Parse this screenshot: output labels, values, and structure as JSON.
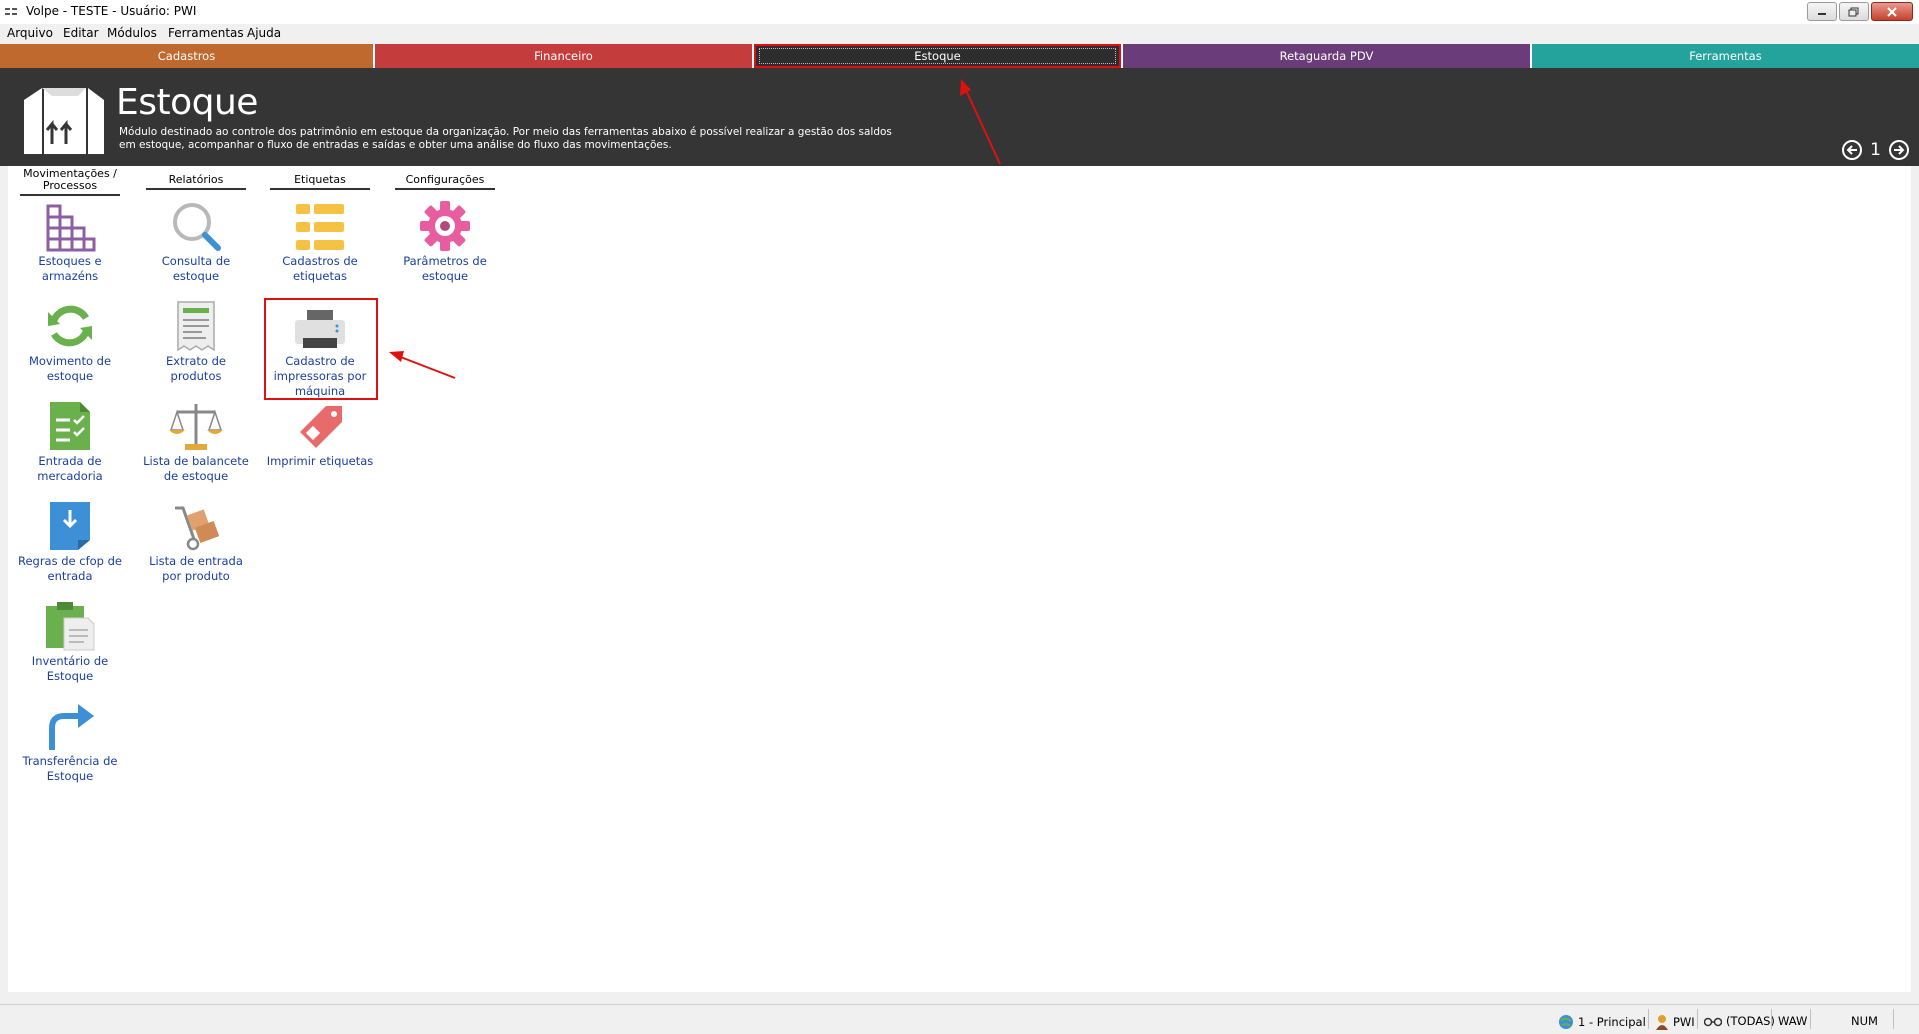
{
  "window": {
    "title": "Volpe - TESTE - Usuário: PWI"
  },
  "menu": [
    "Arquivo",
    "Editar",
    "Módulos",
    "Ferramentas",
    "Ajuda"
  ],
  "tabs": [
    {
      "label": "Cadastros",
      "color": "#c0692f"
    },
    {
      "label": "Financeiro",
      "color": "#c43c3b"
    },
    {
      "label": "Estoque",
      "color": "#2d2d2d"
    },
    {
      "label": "Retaguarda PDV",
      "color": "#6a3d7a"
    },
    {
      "label": "Ferramentas",
      "color": "#23a39b"
    }
  ],
  "header": {
    "title": "Estoque",
    "description": "Módulo destinado ao controle dos patrimônio em estoque da organização. Por meio das ferramentas abaixo é possível realizar a gestão dos saldos em estoque, acompanhar o fluxo de entradas e saídas e obter uma análise do fluxo das movimentações.",
    "page": "1"
  },
  "columns": [
    {
      "label": "Movimentações / Processos",
      "items": [
        "Estoques e armazéns",
        "Movimento de estoque",
        "Entrada de mercadoria",
        "Regras de cfop de entrada",
        "Inventário de Estoque",
        "Transferência de Estoque"
      ]
    },
    {
      "label": "Relatórios",
      "items": [
        "Consulta de estoque",
        "Extrato de produtos",
        "Lista de balancete de estoque",
        "Lista de entrada por produto"
      ]
    },
    {
      "label": "Etiquetas",
      "items": [
        "Cadastros de etiquetas",
        "Cadastro de impressoras por máquina",
        "Imprimir etiquetas"
      ]
    },
    {
      "label": "Configurações",
      "items": [
        "Parâmetros de estoque"
      ]
    }
  ],
  "status": {
    "company": "1 - Principal",
    "user": "PWI",
    "filter": "(TODAS)",
    "code": "WAW",
    "num": "NUM"
  },
  "colors": {
    "highlight": "#e01010",
    "link": "#1a3fa0",
    "header_bg": "#353535"
  }
}
